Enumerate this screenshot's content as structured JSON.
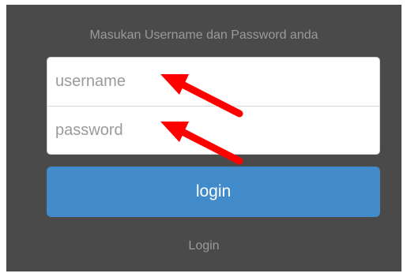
{
  "form": {
    "subtitle": "Masukan Username dan Password anda",
    "username_placeholder": "username",
    "username_value": "",
    "password_placeholder": "password",
    "password_value": "",
    "login_label": "login",
    "footer_label": "Login"
  },
  "annotations": {
    "arrow_color": "#ff0000",
    "arrow_icon": "red-arrow-icon"
  },
  "colors": {
    "panel_bg": "#4a4a4a",
    "button_bg": "#428bca",
    "muted_text": "#9a9a9a"
  }
}
